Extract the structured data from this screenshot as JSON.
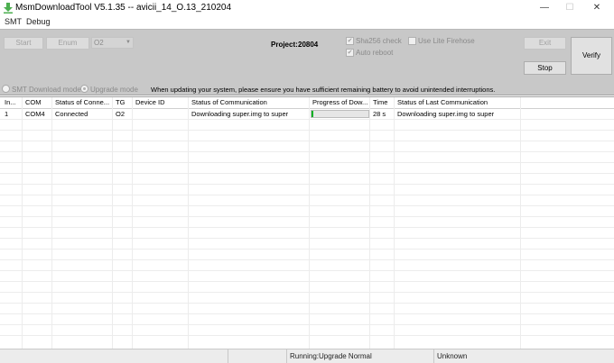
{
  "window": {
    "title": "MsmDownloadTool V5.1.35 -- avicii_14_O.13_210204",
    "controls": {
      "minimize": "—",
      "maximize": "☐",
      "close": "✕"
    }
  },
  "menu": [
    "SMT",
    "Debug"
  ],
  "toolbar": {
    "start_label": "Start",
    "enum_label": "Enum",
    "target_select": "O2",
    "project_label": "Project:",
    "project_value": "20804",
    "sha256_label": "Sha256 check",
    "sha256_checked": true,
    "auto_reboot_label": "Auto reboot",
    "auto_reboot_checked": true,
    "lite_firehose_label": "Use Lite Firehose",
    "lite_firehose_checked": false,
    "exit_label": "Exit",
    "stop_label": "Stop",
    "verify_label": "Verify",
    "smt_mode_label": "SMT Download mode",
    "upgrade_mode_label": "Upgrade mode",
    "selected_mode": "upgrade",
    "notice": "When updating your system, please ensure you have sufficient remaining battery to avoid unintended interruptions."
  },
  "table": {
    "columns": [
      "In...",
      "COM",
      "Status of Conne...",
      "TG",
      "Device ID",
      "Status of Communication",
      "Progress of Dow...",
      "Time",
      "Status of Last Communication"
    ],
    "rows": [
      {
        "index": "1",
        "com": "COM4",
        "connection": "Connected",
        "tg": "O2",
        "device_id": "",
        "communication": "Downloading super.img to super",
        "progress": 0.03,
        "time": "28 s",
        "last_communication": "Downloading super.img to super"
      }
    ]
  },
  "status": {
    "mode": "Running:Upgrade Normal",
    "state": "Unknown"
  },
  "colors": {
    "toolbar_bg": "#c8c8c8",
    "progress_fill": "#06b025",
    "app_icon": "#4caf50"
  }
}
